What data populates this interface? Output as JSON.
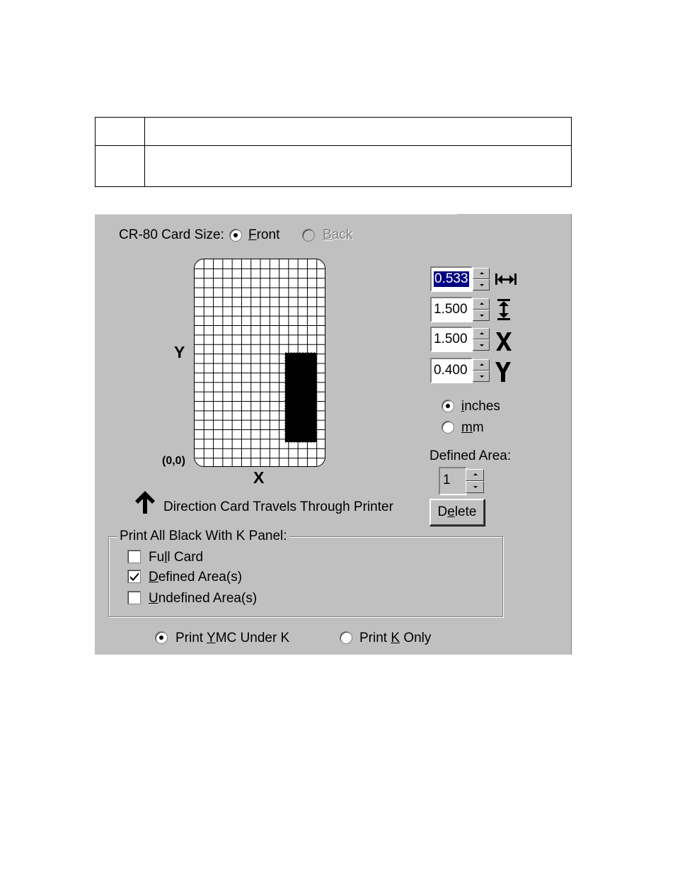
{
  "dialog": {
    "card_size_label": "CR-80 Card Size:",
    "side_front": {
      "pre": "",
      "ul": "F",
      "post": "ront",
      "selected": true
    },
    "side_back": {
      "pre": "",
      "ul": "B",
      "post": "ack",
      "selected": false,
      "disabled": true
    },
    "axis_y_label": "Y",
    "axis_x_label": "X",
    "origin_label": "(0,0)",
    "direction_icon": "arrow-up-icon",
    "direction_text": "Direction Card Travels Through Printer",
    "fields": [
      {
        "value": "0.533",
        "icon": "width-arrows-icon",
        "selected": true
      },
      {
        "value": "1.500",
        "icon": "height-arrows-icon",
        "selected": false
      },
      {
        "value": "1.500",
        "icon": "x-letter-icon",
        "selected": false
      },
      {
        "value": "0.400",
        "icon": "y-letter-icon",
        "selected": false
      }
    ],
    "units": [
      {
        "pre": "",
        "ul": "i",
        "post": "nches",
        "selected": true
      },
      {
        "pre": "",
        "ul": "m",
        "post": "m",
        "selected": false
      }
    ],
    "defined_area_label": "Defined Area:",
    "defined_area_value": "1",
    "delete_button": {
      "pre": "D",
      "ul": "e",
      "post": "lete"
    },
    "group_label": "Print All Black With K Panel:",
    "checkboxes": [
      {
        "pre": "Fu",
        "ul": "l",
        "post": "l Card",
        "checked": false
      },
      {
        "pre": "",
        "ul": "D",
        "post": "efined Area(s)",
        "checked": true
      },
      {
        "pre": "",
        "ul": "U",
        "post": "ndefined Area(s)",
        "checked": false
      }
    ],
    "print_mode": [
      {
        "pre": "Print ",
        "ul": "Y",
        "post": "MC Under K",
        "selected": true
      },
      {
        "pre": "Print ",
        "ul": "K",
        "post": " Only",
        "selected": false
      }
    ],
    "colors": {
      "face": "#c0c0c0",
      "selection": "#000080",
      "area_fill": "#000000"
    }
  }
}
